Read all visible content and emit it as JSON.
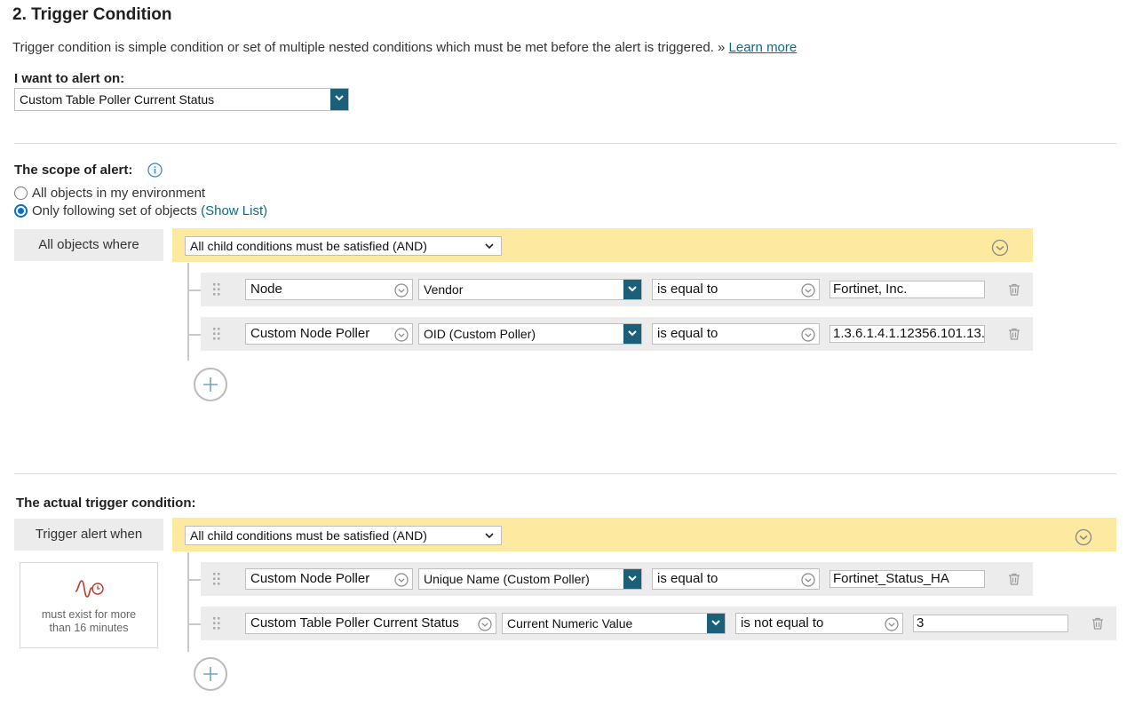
{
  "header": {
    "title": "2. Trigger Condition",
    "description": "Trigger condition is simple condition or set of multiple nested conditions which must be met before the alert is triggered. »",
    "learn_more": "Learn more"
  },
  "alert_on": {
    "label": "I want to alert on:",
    "value": "Custom Table Poller Current Status"
  },
  "scope": {
    "label": "The scope of alert:",
    "radio_all": "All objects in my environment",
    "radio_following": "Only following set of objects",
    "show_list": "(Show List)",
    "group_label": "All objects where",
    "group_operator": "All child conditions must be satisfied (AND)",
    "conditions": [
      {
        "field": "Node",
        "property": "Vendor",
        "operator": "is equal to",
        "value": "Fortinet, Inc."
      },
      {
        "field": "Custom Node Poller",
        "property": "OID (Custom Poller)",
        "operator": "is equal to",
        "value": "1.3.6.1.4.1.12356.101.13."
      }
    ]
  },
  "trigger": {
    "label": "The actual trigger condition:",
    "group_label": "Trigger alert when",
    "group_operator": "All child conditions must be satisfied (AND)",
    "duration_text": "must exist for more than 16 minutes",
    "conditions": [
      {
        "field": "Custom Node Poller",
        "property": "Unique Name (Custom Poller)",
        "operator": "is equal to",
        "value": "Fortinet_Status_HA"
      },
      {
        "field": "Custom Table Poller Current Status",
        "property": "Current Numeric Value",
        "operator": "is not equal to",
        "value": "3"
      }
    ]
  },
  "colors": {
    "accent": "#1b5f78",
    "link": "#0b6a8a",
    "group_bar": "#fde9a0",
    "row_bg": "#ececec"
  }
}
